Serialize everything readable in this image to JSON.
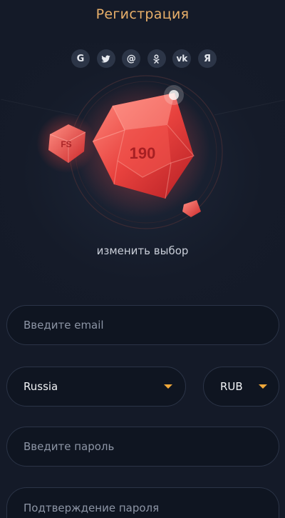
{
  "header": {
    "title": "Регистрация"
  },
  "socials": [
    {
      "icon": "google-icon",
      "glyph": "G"
    },
    {
      "icon": "twitter-icon",
      "glyph": ""
    },
    {
      "icon": "mailru-icon",
      "glyph": "@"
    },
    {
      "icon": "odnoklassniki-icon",
      "glyph": ""
    },
    {
      "icon": "vk-icon",
      "glyph": "vk"
    },
    {
      "icon": "yandex-icon",
      "glyph": "Я"
    }
  ],
  "bonus": {
    "main_value": "190",
    "side_label": "FS",
    "change_label": "изменить выбор"
  },
  "form": {
    "email_placeholder": "Введите email",
    "country_value": "Russia",
    "currency_value": "RUB",
    "password_placeholder": "Введите пароль",
    "confirm_placeholder": "Подтверждение пароля"
  },
  "colors": {
    "background": "#141a28",
    "title": "#e9b06a",
    "accent_caret": "#f0a83a",
    "gem_red": "#e8423e"
  }
}
